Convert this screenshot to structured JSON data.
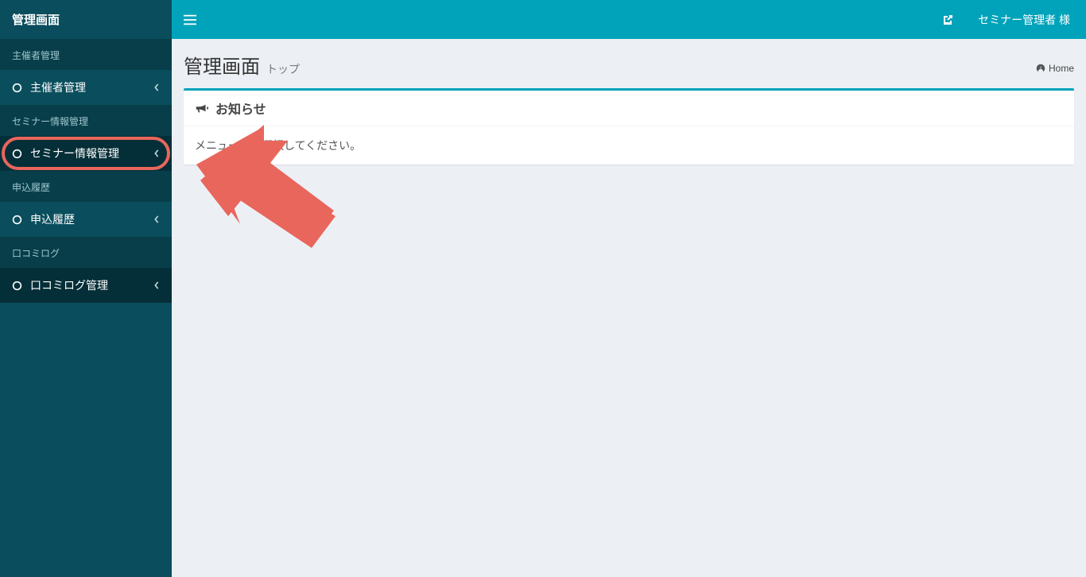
{
  "sidebar": {
    "logo": "管理画面",
    "sections": [
      {
        "header": "主催者管理",
        "item_label": "主催者管理",
        "highlighted": false,
        "dark": false
      },
      {
        "header": "セミナー情報管理",
        "item_label": "セミナー情報管理",
        "highlighted": true,
        "dark": true
      },
      {
        "header": "申込履歴",
        "item_label": "申込履歴",
        "highlighted": false,
        "dark": false
      },
      {
        "header": "口コミログ",
        "item_label": "口コミログ管理",
        "highlighted": false,
        "dark": true
      }
    ]
  },
  "topbar": {
    "user_label": "セミナー管理者 様"
  },
  "page": {
    "title": "管理画面",
    "subtitle": "トップ",
    "breadcrumb_home": "Home"
  },
  "panel": {
    "title": "お知らせ",
    "body": "メニューから選択してください。"
  },
  "colors": {
    "accent": "#00a3ba",
    "sidebar": "#0a4e5d",
    "highlight": "#e8665c"
  }
}
